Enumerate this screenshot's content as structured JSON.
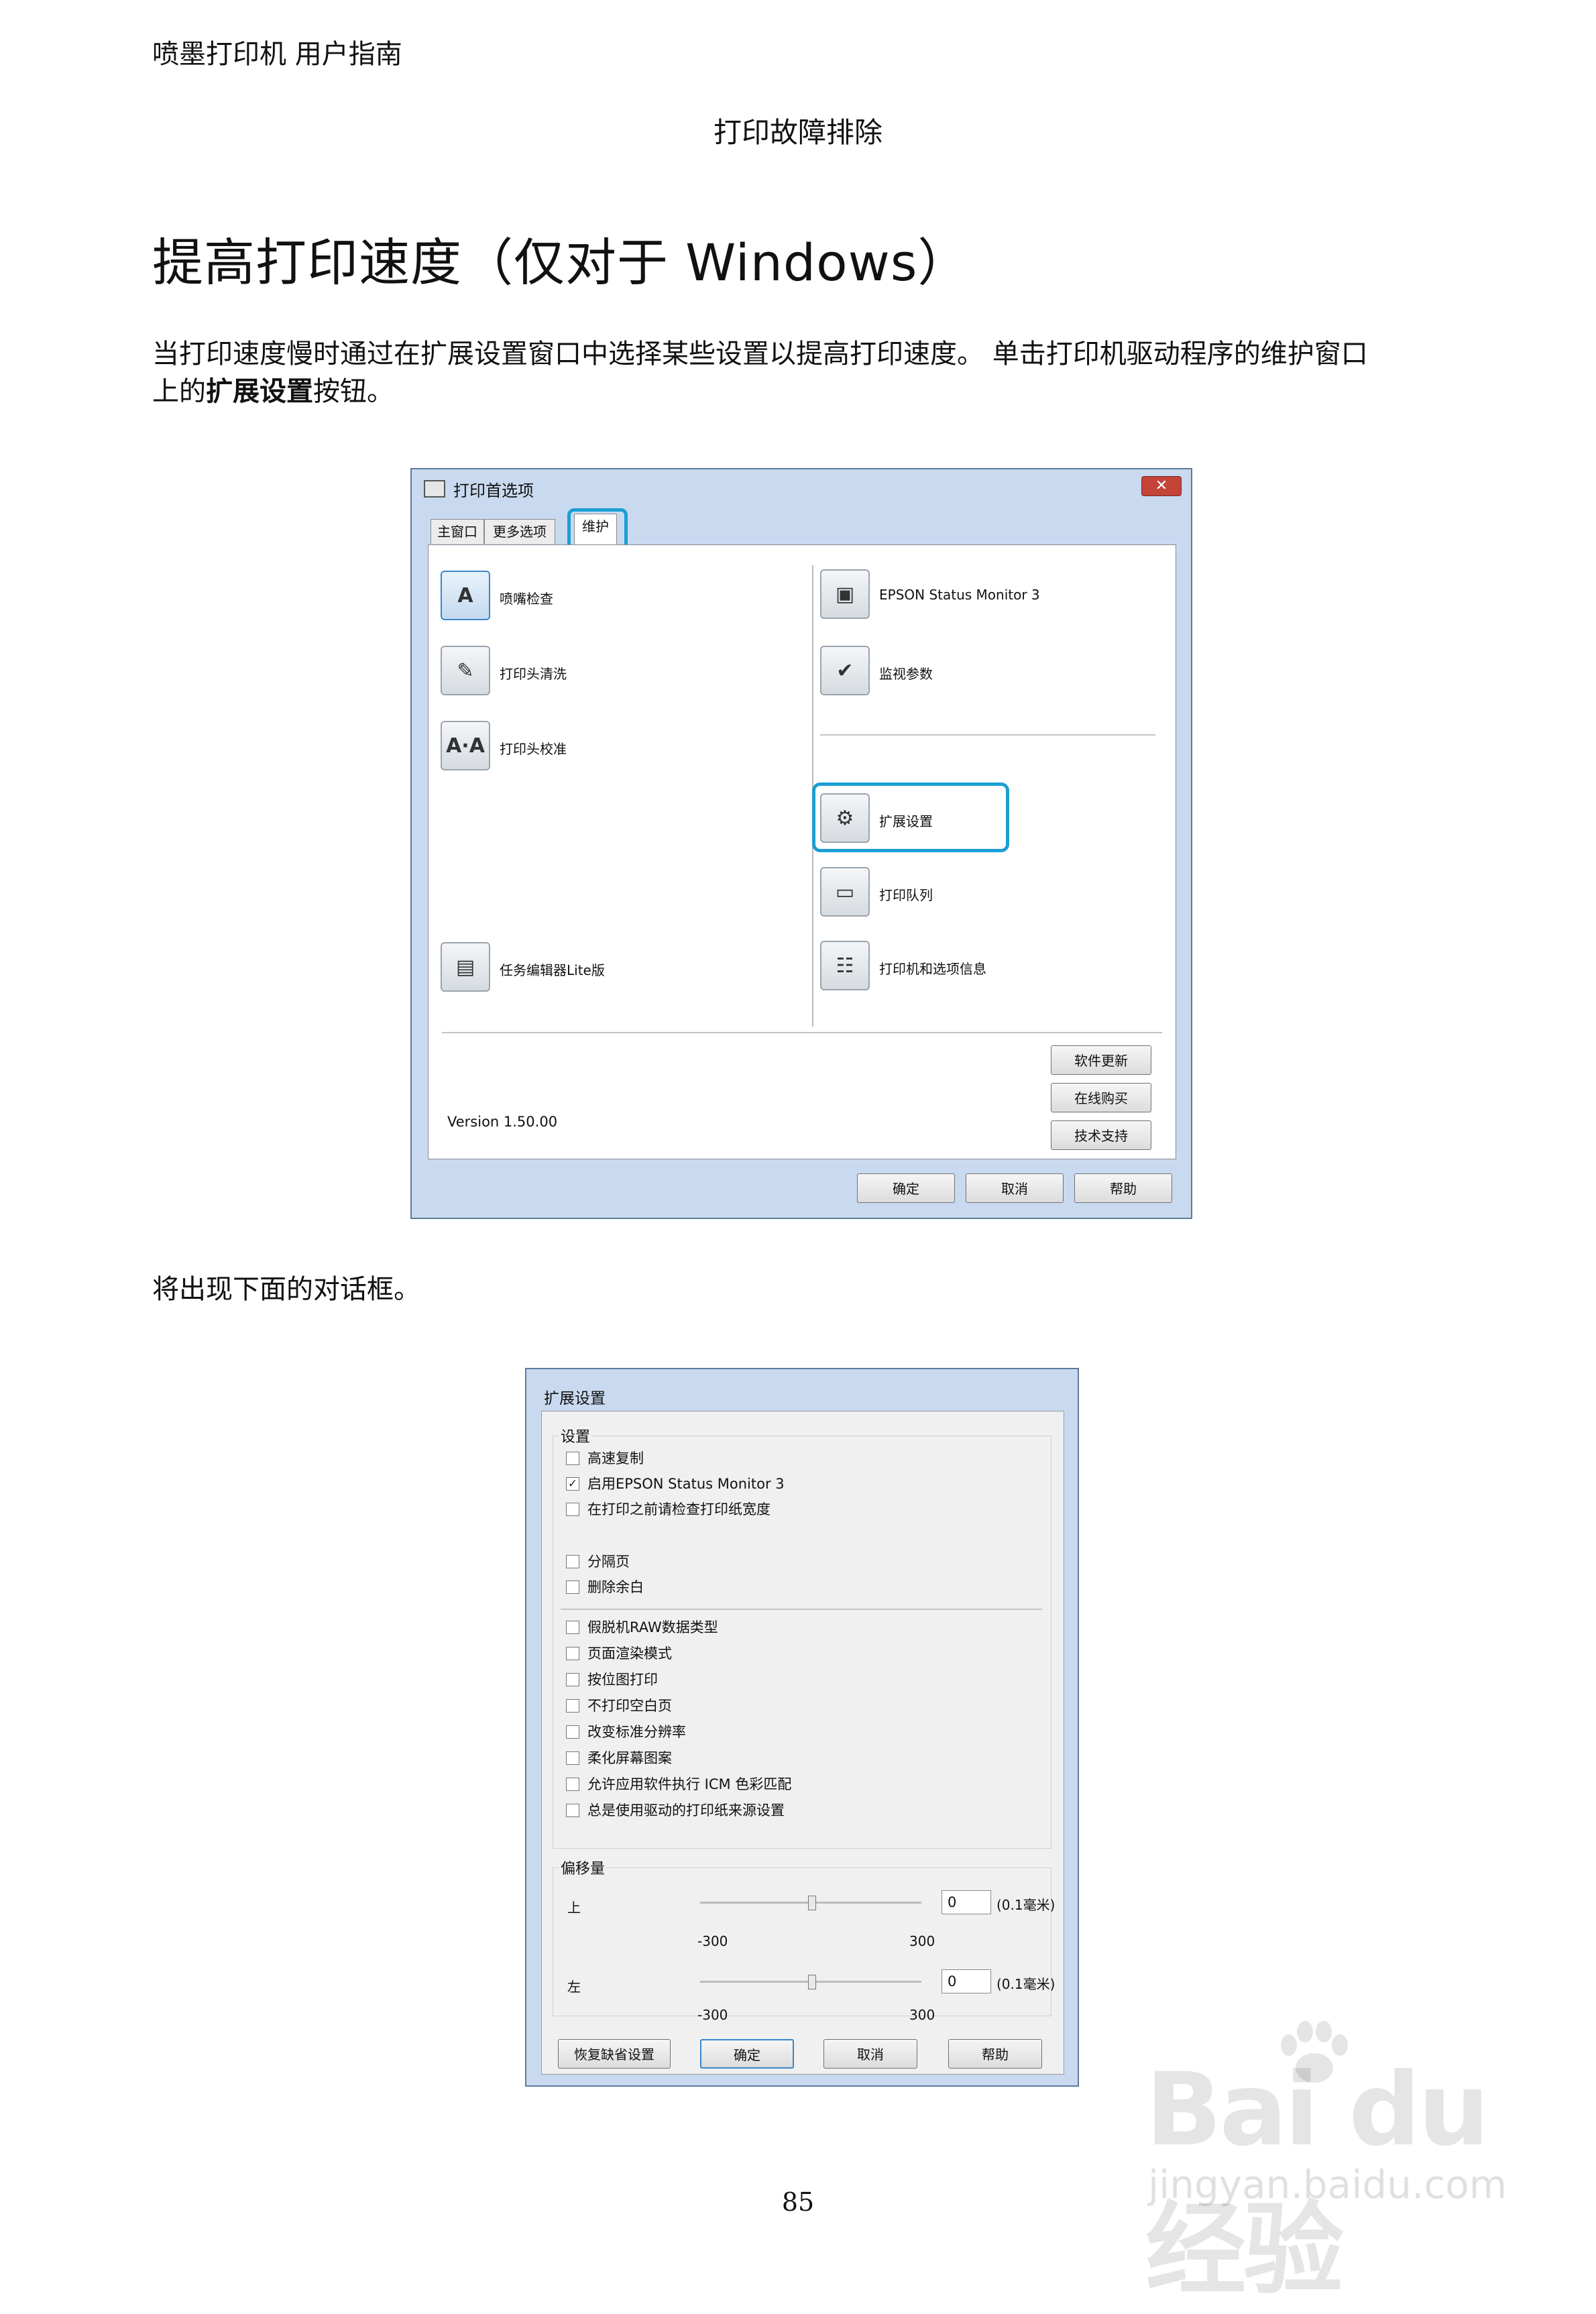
{
  "header": {
    "running_title": "喷墨打印机 用户指南",
    "chapter": "打印故障排除"
  },
  "section": {
    "title": "提高打印速度（仅对于 Windows）",
    "para1_a": "当打印速度慢时通过在扩展设置窗口中选择某些设置以提高打印速度。 单击打印机驱动程序的维护窗口",
    "para1_b": "上的",
    "para1_bold": "扩展设置",
    "para1_c": "按钮。",
    "para2": "将出现下面的对话框。"
  },
  "dialog1": {
    "title": "打印首选项",
    "close": "✕",
    "tabs": [
      "主窗口",
      "更多选项",
      "维护"
    ],
    "left_items": [
      "喷嘴检查",
      "打印头清洗",
      "打印头校准",
      "任务编辑器Lite版"
    ],
    "right_items": [
      "EPSON Status Monitor 3",
      "监视参数",
      "扩展设置",
      "打印队列",
      "打印机和选项信息"
    ],
    "side_buttons": [
      "软件更新",
      "在线购买",
      "技术支持"
    ],
    "version": "Version 1.50.00",
    "bottom_buttons": [
      "确定",
      "取消",
      "帮助"
    ],
    "highlight_color": "#1b9fd4"
  },
  "dialog2": {
    "title": "扩展设置",
    "settings_group": "设置",
    "checkboxes_a": [
      {
        "label": "高速复制",
        "checked": false
      },
      {
        "label": "启用EPSON Status Monitor 3",
        "checked": true
      },
      {
        "label": "在打印之前请检查打印纸宽度",
        "checked": false
      }
    ],
    "checkboxes_b": [
      {
        "label": "分隔页",
        "checked": false
      },
      {
        "label": "删除余白",
        "checked": false
      }
    ],
    "checkboxes_c": [
      {
        "label": "假脱机RAW数据类型",
        "checked": false
      },
      {
        "label": "页面渲染模式",
        "checked": false
      },
      {
        "label": "按位图打印",
        "checked": false
      },
      {
        "label": "不打印空白页",
        "checked": false
      },
      {
        "label": "改变标准分辨率",
        "checked": false
      },
      {
        "label": "柔化屏幕图案",
        "checked": false
      },
      {
        "label": "允许应用软件执行 ICM 色彩匹配",
        "checked": false
      },
      {
        "label": "总是使用驱动的打印纸来源设置",
        "checked": false
      }
    ],
    "offset_group": "偏移量",
    "offset_top_label": "上",
    "offset_left_label": "左",
    "offset_top_value": "0",
    "offset_left_value": "0",
    "unit": "(0.1毫米)",
    "min": "-300",
    "max": "300",
    "buttons": [
      "恢复缺省设置",
      "确定",
      "取消",
      "帮助"
    ]
  },
  "watermark": {
    "brand": "Bai du 经验",
    "url": "jingyan.baidu.com"
  },
  "page_number": "85"
}
